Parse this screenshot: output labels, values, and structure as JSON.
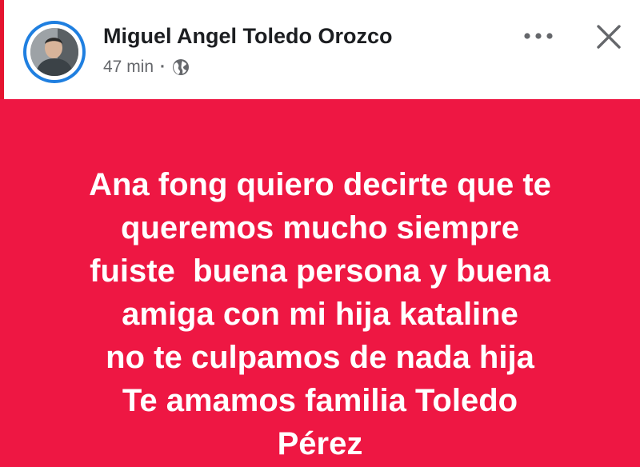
{
  "post": {
    "author": "Miguel Angel Toledo Orozco",
    "timestamp": "47 min",
    "separator": "·",
    "privacy_icon": "globe-icon",
    "more_icon": "more-options-icon",
    "close_icon": "close-icon",
    "text_lines": [
      "Ana fong quiero decirte que te",
      "queremos mucho siempre",
      "fuiste  buena persona y buena",
      "amiga con mi hija kataline",
      "no te culpamos de nada hija",
      "Te amamos familia Toledo",
      "Pérez"
    ]
  },
  "colors": {
    "background": "#ee1743",
    "text": "#ffffff",
    "author": "#1c1e21",
    "meta": "#65676b",
    "avatar_ring": "#1f7fe0",
    "accent_edge": "#e5142f"
  }
}
